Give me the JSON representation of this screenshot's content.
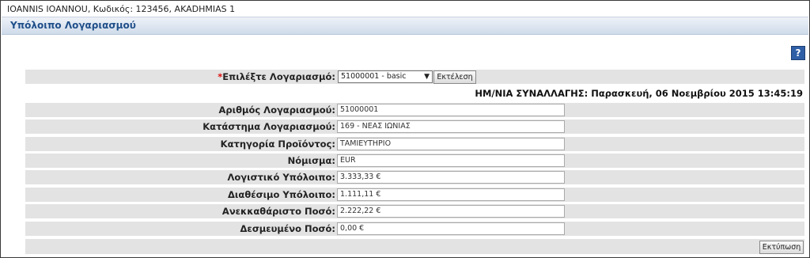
{
  "user_bar": {
    "text": "IOANNIS IOANNOU, Κωδικός: 123456, AKADHMIAS 1"
  },
  "page": {
    "title": "Υπόλοιπο Λογαριασμού"
  },
  "help": {
    "icon": "help-icon",
    "label": "?"
  },
  "select_row": {
    "required_mark": "*",
    "label": "Επιλέξτε Λογαριασμό:",
    "selected": "51000001 - basic",
    "run_label": "Εκτέλεση"
  },
  "transaction_date": "ΗΜ/ΝΙΑ ΣΥΝΑΛΛΑΓΗΣ: Παρασκευή, 06 Νοεμβρίου 2015 13:45:19",
  "fields": [
    {
      "label": "Αριθμός Λογαριασμού:",
      "value": "51000001"
    },
    {
      "label": "Κατάστημα Λογαριασμού:",
      "value": "169 - ΝΕΑΣ ΙΩΝΙΑΣ"
    },
    {
      "label": "Κατηγορία Προϊόντος:",
      "value": "ΤΑΜΙΕΥΤΗΡΙΟ"
    },
    {
      "label": "Νόμισμα:",
      "value": "EUR"
    },
    {
      "label": "Λογιστικό Υπόλοιπο:",
      "value": "3.333,33 €"
    },
    {
      "label": "Διαθέσιμο Υπόλοιπο:",
      "value": "1.111,11 €"
    },
    {
      "label": "Ανεκκαθάριστο Ποσό:",
      "value": "2.222,22 €"
    },
    {
      "label": "Δεσμευμένο Ποσό:",
      "value": "0,00 €"
    }
  ],
  "print_label": "Εκτύπωση",
  "colors": {
    "title_text": "#1f4f8a",
    "row_bg": "#e3e3e3",
    "required": "#dd1111"
  }
}
